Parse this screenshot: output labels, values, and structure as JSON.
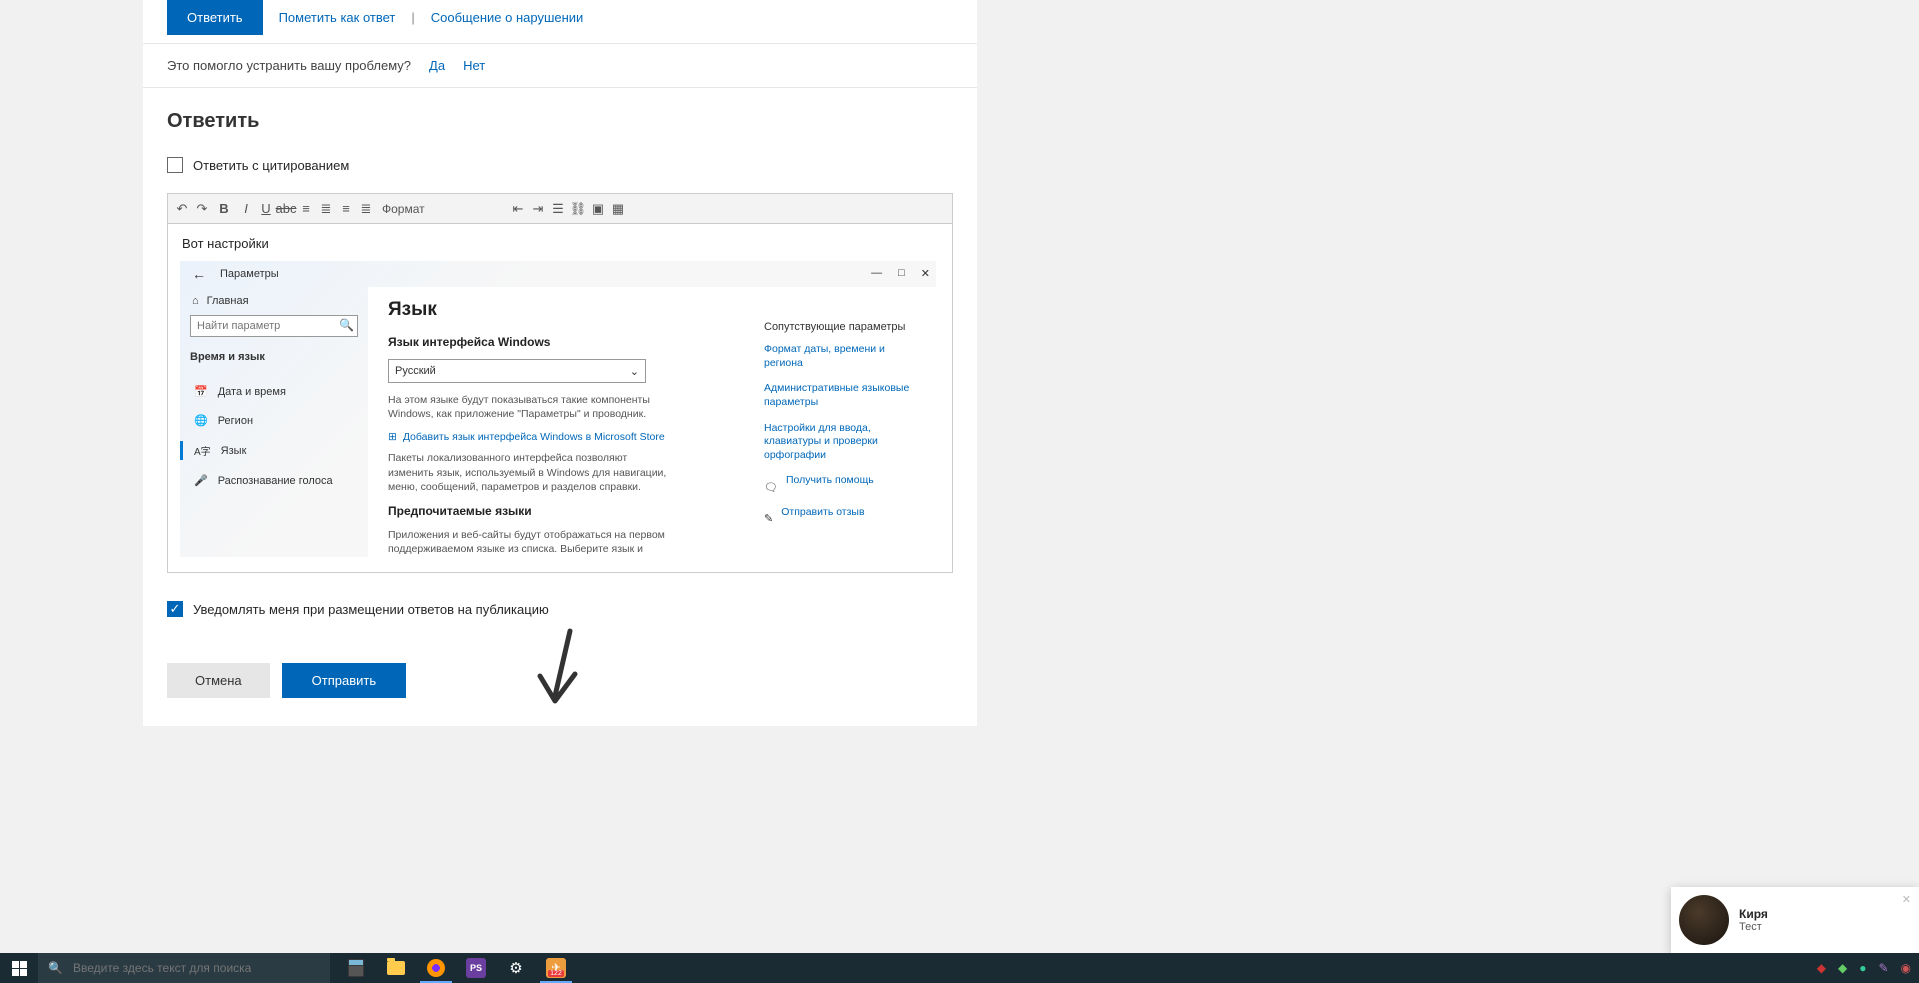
{
  "actions": {
    "reply": "Ответить",
    "mark": "Пометить как ответ",
    "report": "Сообщение о нарушении"
  },
  "help": {
    "question": "Это помогло устранить вашу проблему?",
    "yes": "Да",
    "no": "Нет"
  },
  "reply": {
    "title": "Ответить",
    "quote": "Ответить с цитированием",
    "notify": "Уведомлять меня при размещении ответов на публикацию",
    "cancel": "Отмена",
    "submit": "Отправить"
  },
  "toolbar": {
    "format": "Формат"
  },
  "editor": {
    "intro": "Вот настройки"
  },
  "settings": {
    "params": "Параметры",
    "home": "Главная",
    "search_ph": "Найти параметр",
    "category": "Время и язык",
    "items": {
      "datetime": "Дата и время",
      "region": "Регион",
      "language": "Язык",
      "speech": "Распознавание голоса"
    },
    "h1": "Язык",
    "h2": "Язык интерфейса Windows",
    "sel": "Русский",
    "desc1": "На этом языке будут показываться такие компоненты Windows, как приложение \"Параметры\" и проводник.",
    "addlink": "Добавить язык интерфейса Windows в Microsoft Store",
    "desc2": "Пакеты локализованного интерфейса позволяют изменить язык, используемый в Windows для навигации, меню, сообщений, параметров и разделов справки.",
    "h3": "Предпочитаемые языки",
    "desc3": "Приложения и веб-сайты будут отображаться на первом поддерживаемом языке из списка. Выберите язык и нажмите кнопку \"Параметры\", чтобы настроить клавиатуру и другие",
    "side": {
      "title": "Сопутствующие параметры",
      "l1": "Формат даты, времени и региона",
      "l2": "Административные языковые параметры",
      "l3": "Настройки для ввода, клавиатуры и проверки орфографии",
      "help": "Получить помощь",
      "feedback": "Отправить отзыв"
    }
  },
  "notif": {
    "name": "Киря",
    "msg": "Тест"
  },
  "taskbar": {
    "search_ph": "Введите здесь текст для поиска",
    "tg_badge": "122"
  }
}
